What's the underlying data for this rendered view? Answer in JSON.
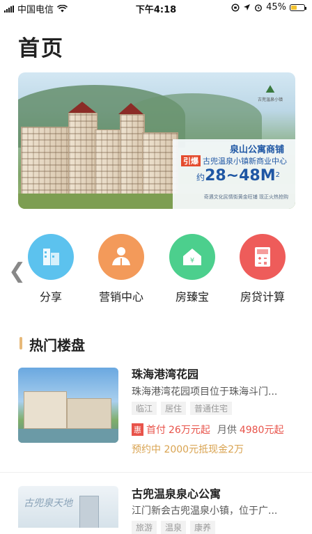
{
  "status_bar": {
    "carrier": "中国电信",
    "time": "下午4:18",
    "battery_percent": "45%",
    "battery_level": 0.45
  },
  "page": {
    "title": "首页"
  },
  "banner": {
    "logo_text": "古兜温泉小镇",
    "line1": "泉山公寓商铺",
    "line2_badge": "引爆",
    "line2": "古兜温泉小镇新商业中心",
    "line3_prefix": "约",
    "line3_value": "28~48M",
    "line3_sup": "2",
    "line4": "奇遇文化民情街黄金旺铺  现正火热抢购"
  },
  "quick_actions": [
    {
      "label": "分享",
      "color": "#5cc2ee",
      "icon": "share-building-icon"
    },
    {
      "label": "营销中心",
      "color": "#f39a5a",
      "icon": "people-icon"
    },
    {
      "label": "房臻宝",
      "color": "#4ccf8d",
      "icon": "house-icon"
    },
    {
      "label": "房贷计算",
      "color": "#ee5c5a",
      "icon": "calculator-icon"
    }
  ],
  "section": {
    "title": "热门楼盘"
  },
  "listings": [
    {
      "name": "珠海港湾花园",
      "desc": "珠海港湾花园项目位于珠海斗门...",
      "tags": [
        "临江",
        "居住",
        "普通住宅"
      ],
      "badge": "惠",
      "down_payment_label": "首付",
      "down_payment": "26万元起",
      "monthly_label": "月供",
      "monthly": "4980元起",
      "presale": "预约中  2000元抵现金2万"
    },
    {
      "name": "古兜温泉泉心公寓",
      "desc": "江门新会古兜温泉小镇，位于广...",
      "tags": [
        "旅游",
        "温泉",
        "康养"
      ],
      "image_text": "古兜泉天地"
    }
  ]
}
